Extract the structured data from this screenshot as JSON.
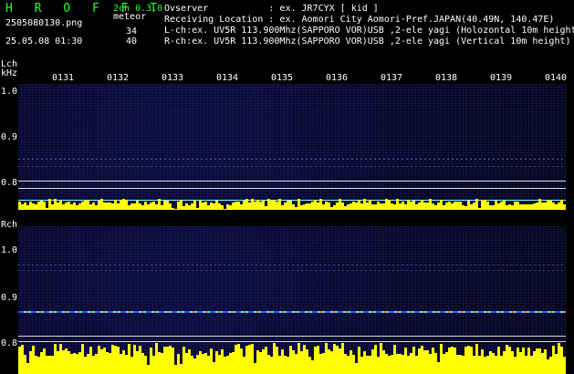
{
  "header": {
    "app_title": "H R O F F T",
    "mode": "2ch 0.3.0",
    "filename": "2505080130.png",
    "meteor_label": "meteor",
    "datetime": "25.05.08 01:30",
    "count_l": "34",
    "count_r": "40",
    "observer_line": "Ovserver           : ex. JR7CYX [ kid ]",
    "location_line": "Receiving Location : ex. Aomori City Aomori-Pref.JAPAN(40.49N, 140.47E)",
    "lch_line": "L-ch:ex. UV5R 113.900Mhz(SAPPORO VOR)USB ,2-ele yagi (Holozontal 10m height)",
    "rch_line": "R-ch:ex. UV5R 113.900Mhz(SAPPORO VOR)USB ,2-ele yagi (Vertical 10m height)"
  },
  "lch": {
    "label": "Lch",
    "unit": "kHz",
    "y_labels": [
      "1.0",
      "0.9",
      "0.8"
    ]
  },
  "rch": {
    "label": "Rch",
    "y_labels": [
      "1.0",
      "0.9",
      "0.8"
    ]
  },
  "time_labels": [
    "0131",
    "0132",
    "0133",
    "0134",
    "0135",
    "0136",
    "0137",
    "0138",
    "0139",
    "0140"
  ],
  "colors": {
    "signal_bars": "#ffff00",
    "trace": "#6fdcff",
    "background": "#000000",
    "header_text": "#ffffff",
    "title_text": "#22ff22"
  }
}
